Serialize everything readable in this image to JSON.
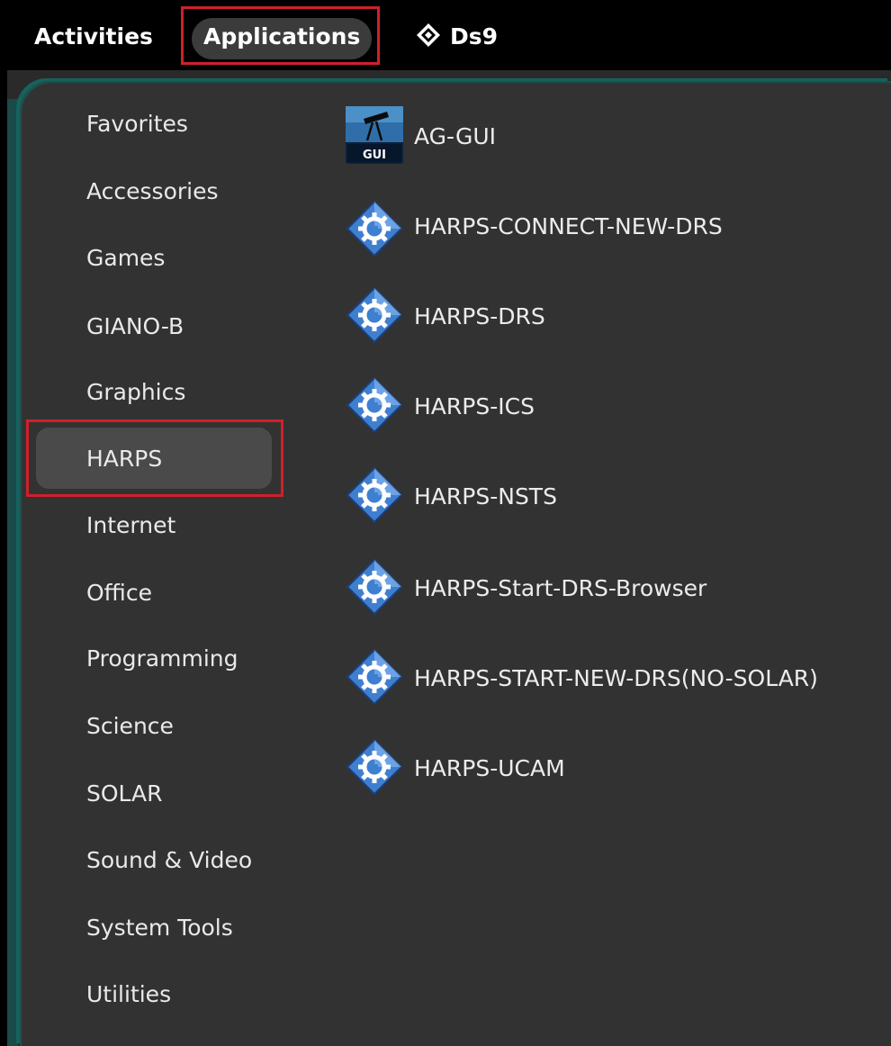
{
  "topbar": {
    "activities": "Activities",
    "applications": "Applications",
    "focused_app": "Ds9",
    "focused_app_icon": "diamond-app-icon"
  },
  "categories": [
    "Favorites",
    "Accessories",
    "Games",
    "GIANO-B",
    "Graphics",
    "HARPS",
    "Internet",
    "Office",
    "Programming",
    "Science",
    "SOLAR",
    "Sound & Video",
    "System Tools",
    "Utilities"
  ],
  "selected_category": "HARPS",
  "apps": [
    {
      "label": "AG-GUI",
      "icon": "telescope-gui-icon"
    },
    {
      "label": "HARPS-CONNECT-NEW-DRS",
      "icon": "gear-diamond-icon"
    },
    {
      "label": "HARPS-DRS",
      "icon": "gear-diamond-icon"
    },
    {
      "label": "HARPS-ICS",
      "icon": "gear-diamond-icon"
    },
    {
      "label": "HARPS-NSTS",
      "icon": "gear-diamond-icon"
    },
    {
      "label": "HARPS-Start-DRS-Browser",
      "icon": "gear-diamond-icon"
    },
    {
      "label": "HARPS-START-NEW-DRS(NO-SOLAR)",
      "icon": "gear-diamond-icon"
    },
    {
      "label": "HARPS-UCAM",
      "icon": "gear-diamond-icon"
    }
  ],
  "gui_icon_text": "GUI",
  "colors": {
    "highlight": "#d0202a",
    "panel": "#323232",
    "accent_teal": "#16625e",
    "icon_blue": "#3f7fd0"
  }
}
